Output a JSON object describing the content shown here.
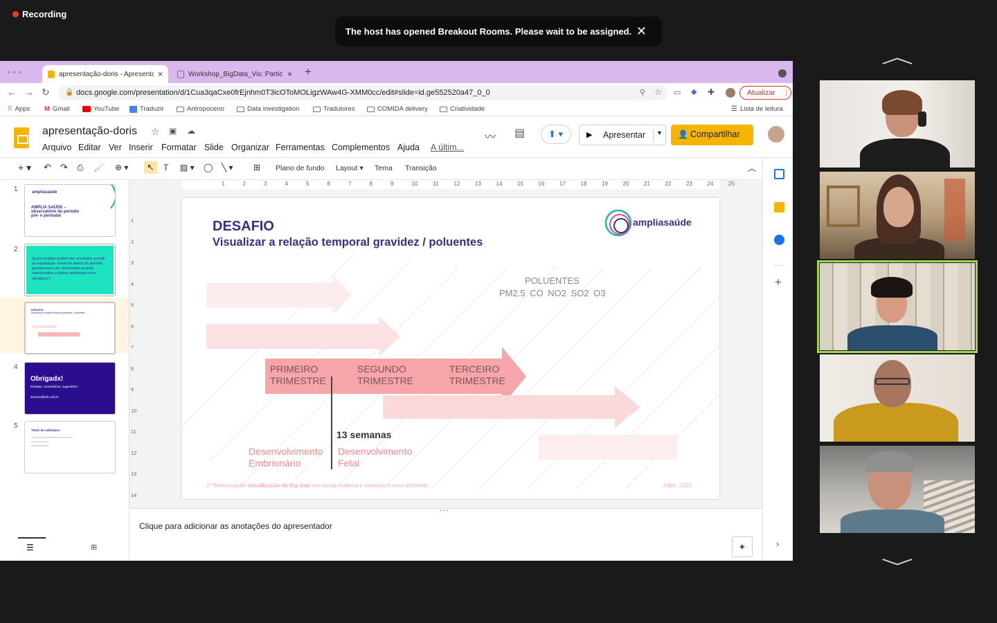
{
  "recording": "Recording",
  "banner": "The host has opened Breakout Rooms. Please wait to be assigned.",
  "browser": {
    "tabs": [
      {
        "label": "apresentação-doris - Apresentações Google"
      },
      {
        "label": "Workshop_BigData_Vis: Participantes"
      }
    ],
    "url": "docs.google.com/presentation/d/1Cua3qaCxe0frEjnhm0T3icOToMOLigzWAw4G-XMM0cc/edit#slide=id.ge552520a47_0_0",
    "update": "Atualizar",
    "bookmarks": [
      "Apps",
      "Gmail",
      "YouTube",
      "Traduzir",
      "Antropoceno",
      "Data investigation",
      "Tradutores",
      "COMIDA delivery",
      "Criatividade"
    ],
    "reading_list": "Lista de leitura"
  },
  "doc": {
    "title": "apresentação-doris",
    "menu": [
      "Arquivo",
      "Editar",
      "Ver",
      "Inserir",
      "Formatar",
      "Slide",
      "Organizar",
      "Ferramentas",
      "Complementos",
      "Ajuda",
      "A últim..."
    ],
    "present": "Apresentar",
    "share": "Compartilhar",
    "toolbar": {
      "background": "Plano de fundo",
      "layout": "Layout",
      "theme": "Tema",
      "transition": "Transição"
    },
    "ruler": [
      "1",
      "2",
      "3",
      "4",
      "5",
      "6",
      "7",
      "8",
      "9",
      "10",
      "11",
      "12",
      "13",
      "14",
      "15",
      "16",
      "17",
      "18",
      "19",
      "20",
      "21",
      "22",
      "23",
      "24",
      "25"
    ],
    "vruler": [
      "1",
      "2",
      "3",
      "4",
      "5",
      "6",
      "7",
      "8",
      "9",
      "10",
      "11",
      "12",
      "13",
      "14"
    ],
    "notes_placeholder": "Clique para adicionar as anotações do apresentador"
  },
  "thumbs": [
    {
      "num": "1",
      "title": "AMPLIA SAÚDE – observatório do período pré- e perinatal",
      "logo": "ampliasaúde"
    },
    {
      "num": "2",
      "text": "Quais insights podem ser revelados a partir da exploração visual de dados do período gestacional e do nascimento quando relacionados a dados ambientais e/ou climáticos?"
    },
    {
      "num": "3",
      "title": "DESAFIO",
      "sub": "Visualizar a relação temporal gravidez / poluentes"
    },
    {
      "num": "4",
      "title": "Obrigadx!",
      "sub": "Dúvidas, comentários, sugestões?",
      "email": "dorisivo@ebu.ufrj.br"
    },
    {
      "num": "5",
      "title": "Título do subtópico"
    }
  ],
  "slide": {
    "title": "DESAFIO",
    "subtitle": "Visualizar a relação temporal gravidez / poluentes",
    "logo": "ampliasaúde",
    "pollutants_label": "POLUENTES",
    "pollutants": "PM2.5  CO  NO2  SO2  O3",
    "t1a": "PRIMEIRO",
    "t1b": "TRIMESTRE",
    "t2a": "SEGUNDO",
    "t2b": "TRIMESTRE",
    "t3a": "TERCEIRO",
    "t3b": "TRIMESTRE",
    "weeks": "13 semanas",
    "dev1a": "Desenvolvimento",
    "dev1b": "Embrionário",
    "dev2a": "Desenvolvimento",
    "dev2b": "Fetal",
    "footer_pre": "1º Workshop de ",
    "footer_bold": "visualização de big data",
    "footer_post": " em saúde materna e neonatal e meio ambiente",
    "date": "Julho, 2021"
  },
  "colors": {
    "tabbar": "#d9b8f0",
    "accent": "#f4b400",
    "arrow": "#f4a3a8",
    "purple": "#3c2c86"
  }
}
